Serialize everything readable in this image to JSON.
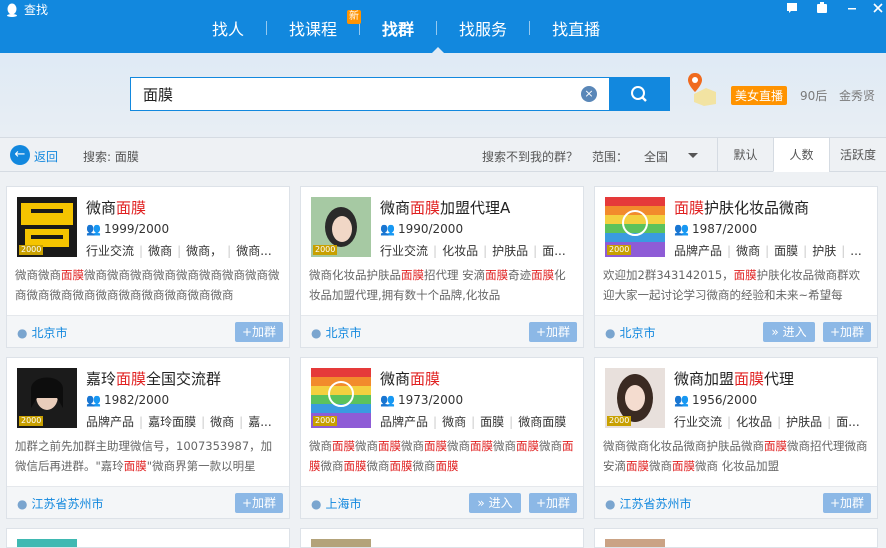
{
  "window": {
    "title": "查找",
    "controls": [
      "feedback-icon",
      "skin-icon",
      "minimize-icon",
      "close-icon"
    ]
  },
  "nav": {
    "tabs": [
      {
        "label": "找人",
        "active": false
      },
      {
        "label": "找课程",
        "badge": "新",
        "active": false
      },
      {
        "label": "找群",
        "active": true
      },
      {
        "label": "找服务",
        "active": false
      },
      {
        "label": "找直播",
        "active": false
      }
    ]
  },
  "search": {
    "value": "面膜",
    "beauty_live": "美女直播",
    "tags": [
      "90后",
      "金秀贤"
    ]
  },
  "filter": {
    "back_label": "返回",
    "search_prefix": "搜索:",
    "search_term": "面膜",
    "not_found": "搜索不到我的群？",
    "scope_label": "范围：",
    "scope_value": "全国",
    "sort": [
      {
        "label": "默认",
        "active": false
      },
      {
        "label": "人数",
        "active": true
      },
      {
        "label": "活跃度",
        "active": false
      }
    ]
  },
  "cards": [
    {
      "name_parts": [
        "微商",
        "面膜",
        ""
      ],
      "members": "1999/2000",
      "tags": [
        "行业交流",
        "微商",
        "微商，",
        "微商..."
      ],
      "desc_parts": [
        "微商微商",
        "面膜",
        "微商微商微商微商微商微商微商微商微商微商微商微商微商微商微商微商微商微商"
      ],
      "city": "北京市",
      "buttons": [
        "+加群"
      ],
      "avatar": "microbiz",
      "count": "2000"
    },
    {
      "name_parts": [
        "微商",
        "面膜",
        "加盟代理A"
      ],
      "members": "1990/2000",
      "tags": [
        "行业交流",
        "化妆品",
        "护肤品",
        "面..."
      ],
      "desc_parts": [
        "微商化妆品护肤品",
        "面膜",
        "招代理 安滴",
        "面膜",
        "奇迹",
        "面膜",
        "化妆品加盟代理,拥有数十个品牌,化妆品"
      ],
      "city": "北京市",
      "buttons": [
        "+加群"
      ],
      "avatar": "girl1",
      "count": "2000"
    },
    {
      "name_parts": [
        "",
        "面膜",
        "护肤化妆品微商"
      ],
      "members": "1987/2000",
      "tags": [
        "品牌产品",
        "微商",
        "面膜",
        "护肤",
        "..."
      ],
      "desc_parts": [
        "欢迎加2群343142015，",
        "面膜",
        "护肤化妆品微商群欢迎大家一起讨论学习微商的经验和未来~希望每"
      ],
      "city": "北京市",
      "buttons": [
        "» 进入",
        "+加群"
      ],
      "avatar": "rainbow",
      "count": "2000"
    },
    {
      "name_parts": [
        "嘉玲",
        "面膜",
        "全国交流群"
      ],
      "members": "1982/2000",
      "tags": [
        "品牌产品",
        "嘉玲面膜",
        "微商",
        "嘉..."
      ],
      "desc_parts": [
        "加群之前先加群主助理微信号，1007353987，加微信后再进群。\"嘉玲",
        "面膜",
        "\"微商界第一款以明星"
      ],
      "city": "江苏省苏州市",
      "buttons": [
        "+加群"
      ],
      "avatar": "star",
      "count": "2000"
    },
    {
      "name_parts": [
        "微商",
        "面膜",
        ""
      ],
      "members": "1973/2000",
      "tags": [
        "品牌产品",
        "微商",
        "面膜",
        "微商面膜"
      ],
      "desc_parts": [
        "微商",
        "面膜",
        "微商",
        "面膜",
        "微商",
        "面膜",
        "微商",
        "面膜",
        "微商",
        "面膜",
        "微商",
        "面膜",
        "微商",
        "面膜",
        "微商",
        "面膜",
        "微商",
        "面膜",
        ""
      ],
      "city": "上海市",
      "buttons": [
        "» 进入",
        "+加群"
      ],
      "avatar": "rainbow",
      "count": "2000"
    },
    {
      "name_parts": [
        "微商加盟",
        "面膜",
        "代理"
      ],
      "members": "1956/2000",
      "tags": [
        "行业交流",
        "化妆品",
        "护肤品",
        "面..."
      ],
      "desc_parts": [
        "微商微商化妆品微商护肤品微商",
        "面膜",
        "微商招代理微商安滴",
        "面膜",
        "微商",
        "面膜",
        "微商 化妆品加盟"
      ],
      "city": "江苏省苏州市",
      "buttons": [
        "+加群"
      ],
      "avatar": "girl2",
      "count": "2000"
    }
  ],
  "colors": {
    "primary": "#1288de",
    "highlight": "#e02020",
    "accent": "#ff9300"
  }
}
